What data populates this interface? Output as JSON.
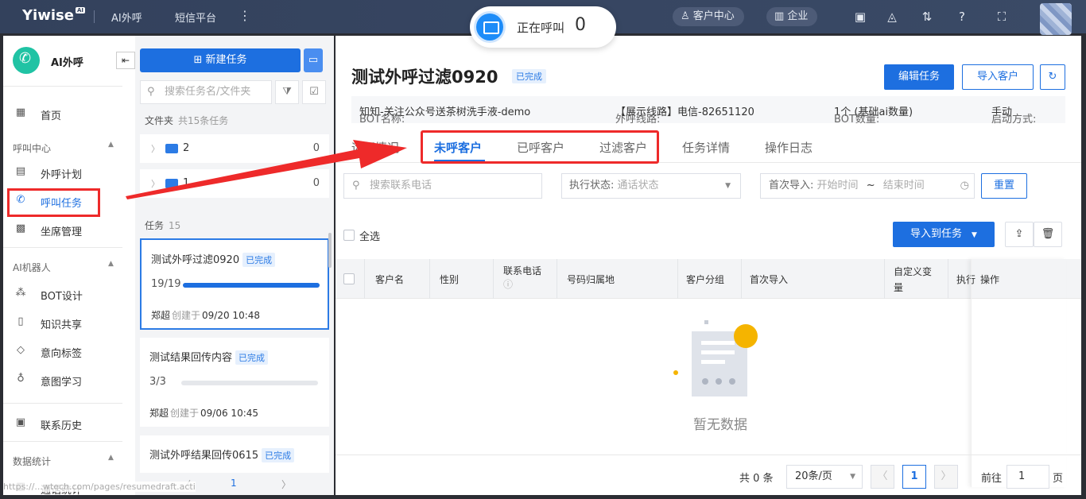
{
  "topbar": {
    "logo": "Yiwise",
    "logo_sup": "AI",
    "nav": [
      "AI外呼",
      "短信平台"
    ],
    "customer_center": "客户中心",
    "enterprise": "企业"
  },
  "calling": {
    "label": "正在呼叫",
    "count": "0"
  },
  "sidebar": {
    "title": "AI外呼",
    "home": "首页",
    "group_call_center": "呼叫中心",
    "call_plan": "外呼计划",
    "call_task": "呼叫任务",
    "seat_management": "坐席管理",
    "group_ai_robot": "AI机器人",
    "bot_design": "BOT设计",
    "knowledge_share": "知识共享",
    "intent_tag": "意向标签",
    "intent_learning": "意图学习",
    "contact_history": "联系历史",
    "group_data_stats": "数据统计",
    "call_stats": "通话统计"
  },
  "task_panel": {
    "new_task": "新建任务",
    "search_placeholder": "搜索任务名/文件夹",
    "folder_label": "文件夹",
    "folder_sub": "共15条任务",
    "folders": [
      {
        "name": "2",
        "count": "0"
      },
      {
        "name": "1",
        "count": "0"
      }
    ],
    "task_label": "任务",
    "task_count": "15",
    "tasks": [
      {
        "name": "测试外呼过滤0920",
        "status": "已完成",
        "progress": "19/19",
        "fraction": 1.0,
        "creator": "郑超",
        "created_label": "创建于",
        "time": "09/20 10:48"
      },
      {
        "name": "测试结果回传内容",
        "status": "已完成",
        "progress": "3/3",
        "fraction": 0.0,
        "creator": "郑超",
        "created_label": "创建于",
        "time": "09/06 10:45"
      },
      {
        "name": "测试外呼结果回传0615",
        "status": "已完成"
      }
    ],
    "page": "1"
  },
  "main": {
    "title": "测试外呼过滤0920",
    "status": "已完成",
    "edit_task": "编辑任务",
    "import_customer": "导入客户",
    "info": {
      "bot_label": "BOT名称:",
      "bot_value": "知知-关注公众号送茶树洗手液-demo",
      "line_label": "外呼线路:",
      "line_value": "【展示线路】电信-82651120",
      "bot_count_label": "BOT数量:",
      "bot_count_value": "1个 (基础ai数量)",
      "start_label": "启动方式:",
      "start_value": "手动"
    },
    "tabs": [
      "运行情况",
      "未呼客户",
      "已呼客户",
      "过滤客户",
      "任务详情",
      "操作日志"
    ],
    "filters": {
      "phone_placeholder": "搜索联系电话",
      "exec_label": "执行状态:",
      "exec_placeholder": "通话状态",
      "import_label": "首次导入:",
      "start_placeholder": "开始时间",
      "range_sep": "~",
      "end_placeholder": "结束时间",
      "reset": "重置"
    },
    "select_all": "全选",
    "import_to_task": "导入到任务",
    "columns": [
      "客户名",
      "性别",
      "联系电话",
      "号码归属地",
      "客户分组",
      "首次导入",
      "自定义变量",
      "执行",
      "操作"
    ],
    "empty": "暂无数据",
    "footer": {
      "total": "共 0 条",
      "page_size": "20条/页",
      "page": "1",
      "goto_label": "前往",
      "goto_value": "1",
      "page_unit": "页"
    }
  },
  "status_url": "https://...wtech.com/pages/resumedraft.acti",
  "colors": {
    "primary": "#1d6fe0",
    "highlight": "#ee2a2a",
    "topbar": "#33415c"
  }
}
